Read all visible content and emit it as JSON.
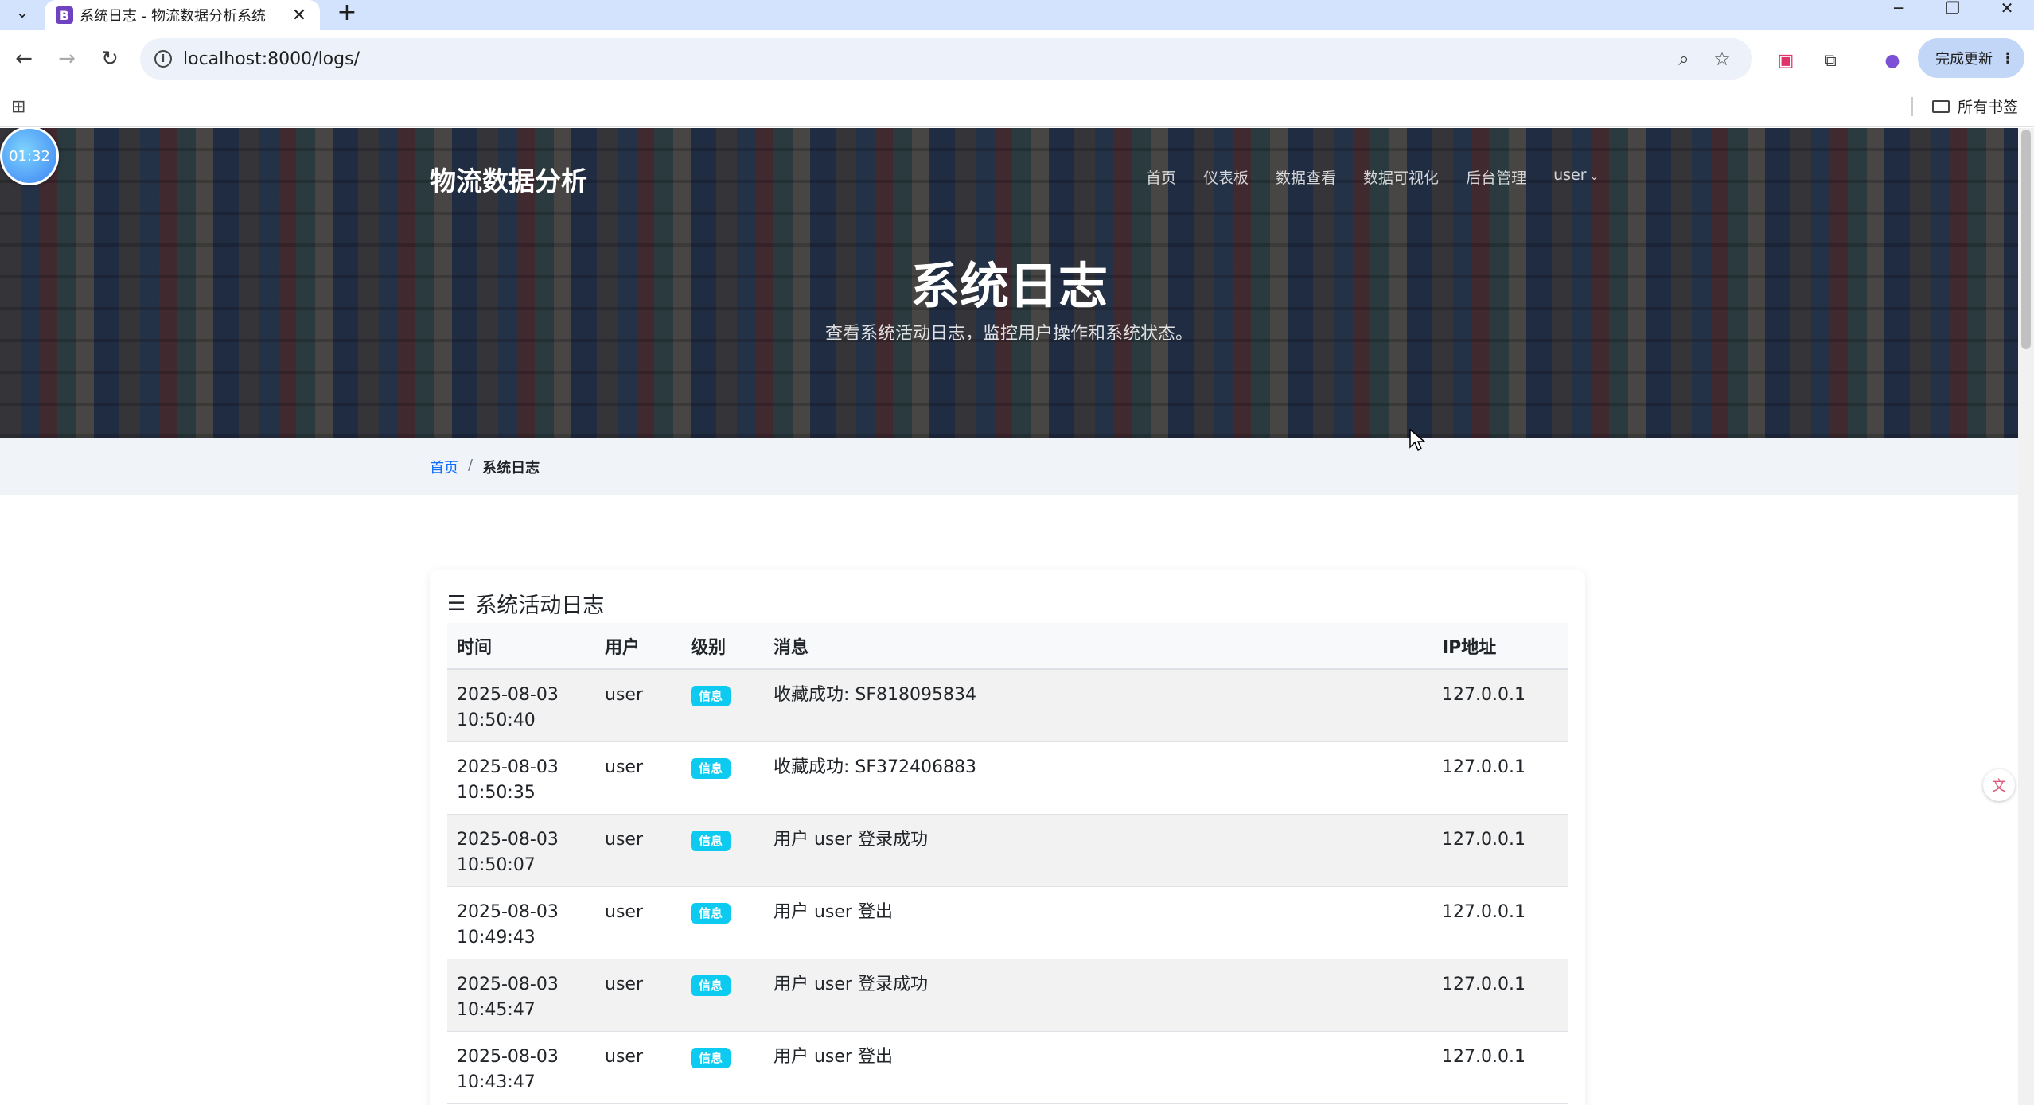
{
  "browser": {
    "tab_title": "系统日志 - 物流数据分析系统",
    "tab_favicon": "B",
    "url": "localhost:8000/logs/",
    "update_label": "完成更新",
    "bookmarks_all": "所有书签"
  },
  "timer": "01:32",
  "site": {
    "brand": "物流数据分析",
    "nav": [
      "首页",
      "仪表板",
      "数据查看",
      "数据可视化",
      "后台管理"
    ],
    "user": "user"
  },
  "hero": {
    "title": "系统日志",
    "subtitle": "查看系统活动日志，监控用户操作和系统状态。"
  },
  "breadcrumb": {
    "home": "首页",
    "separator": "/",
    "current": "系统日志"
  },
  "card": {
    "title": "系统活动日志",
    "columns": [
      "时间",
      "用户",
      "级别",
      "消息",
      "IP地址"
    ],
    "rows": [
      {
        "date": "2025-08-03",
        "time": "10:50:40",
        "user": "user",
        "level": "信息",
        "message": "收藏成功: SF818095834",
        "ip": "127.0.0.1"
      },
      {
        "date": "2025-08-03",
        "time": "10:50:35",
        "user": "user",
        "level": "信息",
        "message": "收藏成功: SF372406883",
        "ip": "127.0.0.1"
      },
      {
        "date": "2025-08-03",
        "time": "10:50:07",
        "user": "user",
        "level": "信息",
        "message": "用户 user 登录成功",
        "ip": "127.0.0.1"
      },
      {
        "date": "2025-08-03",
        "time": "10:49:43",
        "user": "user",
        "level": "信息",
        "message": "用户 user 登出",
        "ip": "127.0.0.1"
      },
      {
        "date": "2025-08-03",
        "time": "10:45:47",
        "user": "user",
        "level": "信息",
        "message": "用户 user 登录成功",
        "ip": "127.0.0.1"
      },
      {
        "date": "2025-08-03",
        "time": "10:43:47",
        "user": "user",
        "level": "信息",
        "message": "用户 user 登出",
        "ip": "127.0.0.1"
      }
    ]
  },
  "colors": {
    "badge_info": "#0dcaf0",
    "link": "#0d6efd",
    "tabbar": "#d3e3fd"
  }
}
